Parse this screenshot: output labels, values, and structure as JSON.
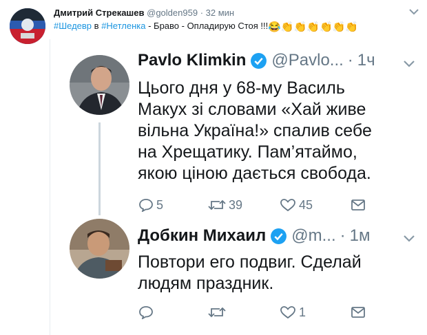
{
  "outer": {
    "author_name": "Дмитрий Стрекашев",
    "handle": "@golden959",
    "separator": "·",
    "time": "32 мин",
    "tweet_hashtag1": "#Шедевр",
    "tweet_word_in": " в ",
    "tweet_hashtag2": "#Нетленка",
    "tweet_rest": " - Браво - Опладирую Стоя !!!",
    "tweet_emojis": "😂👏👏👏👏👏👏"
  },
  "quoted": [
    {
      "name": "Pavlo Klimkin",
      "handle": "@Pavlo...",
      "separator": "·",
      "time": "1ч",
      "text_lines": [
        "Цього дня у 68-му Василь",
        "Макух зі словами «Хай живе",
        "вільна Україна!» спалив себе",
        "на Хрещатику. Пам’ятаймо,",
        "якою ціною дається свобода."
      ],
      "replies": "5",
      "retweets": "39",
      "likes": "45"
    },
    {
      "name": "Добкин Михаил",
      "handle": "@m...",
      "separator": "·",
      "time": "1м",
      "text_lines": [
        "Повтори его подвиг. Сделай",
        "людям праздник."
      ],
      "replies": "",
      "retweets": "",
      "likes": "1"
    }
  ],
  "colors": {
    "link": "#1b95e0",
    "muted": "#657786",
    "verified": "#1da1f2",
    "thread_line": "#ccd6dd"
  },
  "icons": [
    "caret-down-icon",
    "verified-badge-icon",
    "reply-icon",
    "retweet-icon",
    "like-icon",
    "message-icon"
  ]
}
